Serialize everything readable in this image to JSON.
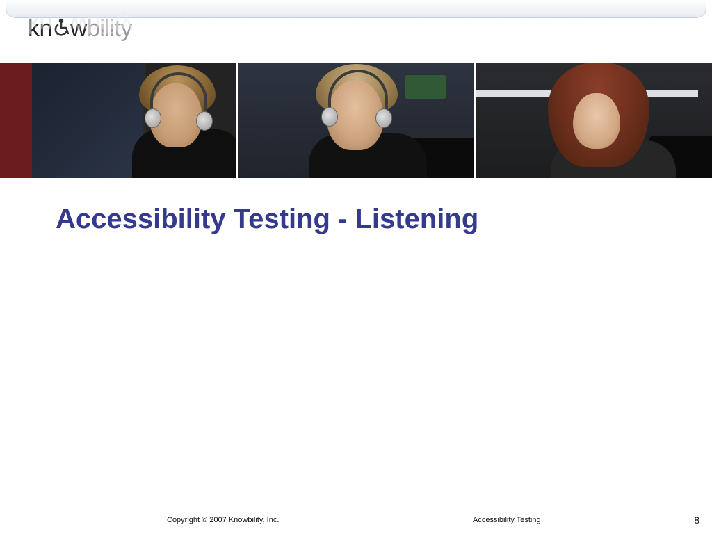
{
  "logo": {
    "part1": "kn",
    "part2": "w",
    "part3": "bility",
    "alt": "knowbility"
  },
  "slide": {
    "title": "Accessibility Testing - Listening"
  },
  "footer": {
    "copyright": "Copyright © 2007 Knowbility, Inc.",
    "section": "Accessibility Testing",
    "page_number": "8"
  },
  "colors": {
    "title": "#343a8d",
    "logo_gray": "#999999"
  }
}
